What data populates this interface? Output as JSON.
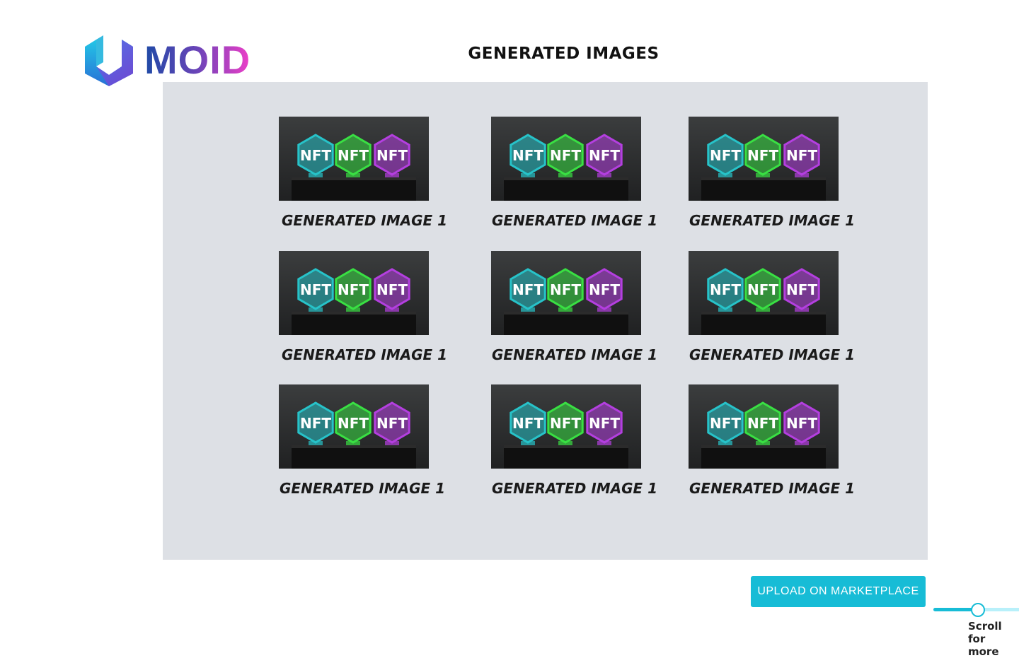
{
  "logo": {
    "text": "MOID"
  },
  "header": {
    "title": "GENERATED IMAGES"
  },
  "gallery": {
    "items": [
      {
        "label": "GENERATED IMAGE 1"
      },
      {
        "label": "GENERATED IMAGE 1"
      },
      {
        "label": "GENERATED IMAGE 1"
      },
      {
        "label": "GENERATED IMAGE 1"
      },
      {
        "label": "GENERATED IMAGE 1"
      },
      {
        "label": "GENERATED IMAGE 1"
      },
      {
        "label": "GENERATED IMAGE 1"
      },
      {
        "label": "GENERATED IMAGE 1"
      },
      {
        "label": "GENERATED IMAGE 1"
      }
    ],
    "thumbnail_text": "NFT",
    "thumbnail_colors": [
      "#27c3c9",
      "#39e043",
      "#b43fe0"
    ]
  },
  "scroll": {
    "caption": "Scroll for more",
    "value": 0.33
  },
  "actions": {
    "upload_label": "UPLOAD ON MARKETPLACE"
  },
  "colors": {
    "accent": "#17bcd6",
    "panel": "#dde0e5"
  }
}
